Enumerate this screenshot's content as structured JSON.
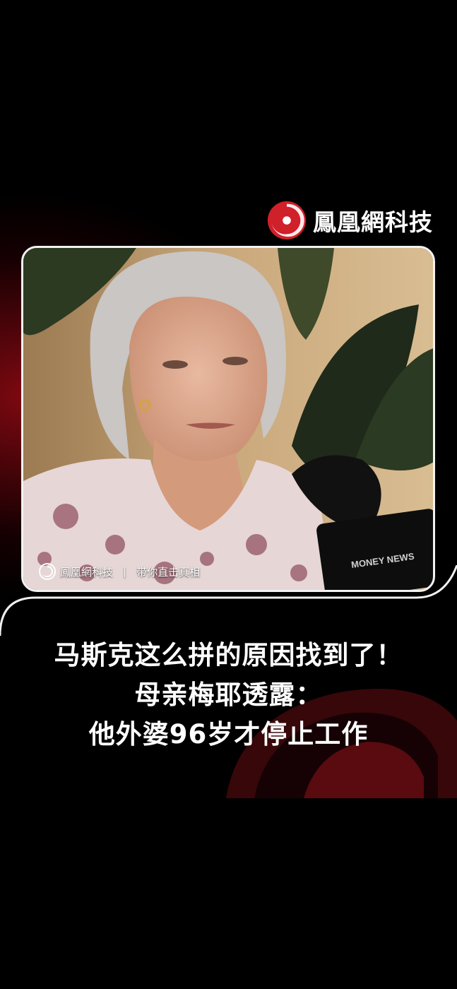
{
  "brand": {
    "name": "鳳凰網科技",
    "logo_icon": "phoenix-logo-icon",
    "accent_color": "#d0202a"
  },
  "video": {
    "caption_brand": "鳳凰網科技",
    "caption_separator": "|",
    "caption_slogan": "带你直击真相",
    "mic_text": "MONEY NEWS"
  },
  "headline": {
    "line1": "马斯克这么拼的原因找到了！",
    "line2": "母亲梅耶透露：",
    "line3": "他外婆96岁才停止工作"
  }
}
